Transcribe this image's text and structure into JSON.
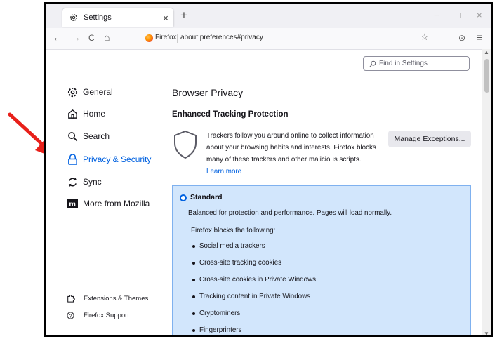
{
  "tab": {
    "title": "Settings",
    "close": "×",
    "new": "+"
  },
  "window": {
    "minimize": "−",
    "maximize": "□",
    "close": "×"
  },
  "nav": {
    "back": "←",
    "forward": "→",
    "reload": "C",
    "home": "⌂",
    "source": "Firefox",
    "url": "about:preferences#privacy",
    "star": "☆",
    "pocket": "⊙",
    "menu": "≡"
  },
  "search": {
    "placeholder": "Find in Settings"
  },
  "sidebar": {
    "items": [
      {
        "label": "General",
        "icon": "gear-icon"
      },
      {
        "label": "Home",
        "icon": "home-icon"
      },
      {
        "label": "Search",
        "icon": "search-icon"
      },
      {
        "label": "Privacy & Security",
        "icon": "lock-icon",
        "active": true
      },
      {
        "label": "Sync",
        "icon": "sync-icon"
      },
      {
        "label": "More from Mozilla",
        "icon": "mozilla-m-icon"
      }
    ],
    "footer": [
      {
        "label": "Extensions & Themes",
        "icon": "puzzle-icon"
      },
      {
        "label": "Firefox Support",
        "icon": "help-icon"
      }
    ]
  },
  "main": {
    "title": "Browser Privacy",
    "etp_heading": "Enhanced Tracking Protection",
    "etp_desc": "Trackers follow you around online to collect information about your browsing habits and interests. Firefox blocks many of these trackers and other malicious scripts.",
    "learn_more": "Learn more",
    "manage_button": "Manage Exceptions...",
    "standard": {
      "label": "Standard",
      "description": "Balanced for protection and performance. Pages will load normally.",
      "blocks_heading": "Firefox blocks the following:",
      "items": [
        "Social media trackers",
        "Cross-site tracking cookies",
        "Cross-site cookies in Private Windows",
        "Tracking content in Private Windows",
        "Cryptominers",
        "Fingerprinters"
      ]
    }
  },
  "colors": {
    "accent": "#0061e0",
    "panel_bg": "#d2e6fc",
    "arrow": "#e8201a"
  }
}
